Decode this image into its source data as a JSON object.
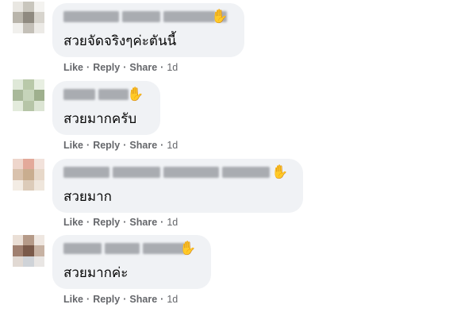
{
  "comments": [
    {
      "text": "สวยจัดจริงๆค่ะตันนี้",
      "like": "Like",
      "reply": "Reply",
      "share": "Share",
      "time": "1d",
      "badge_icon": "waving-hand-icon"
    },
    {
      "text": "สวยมากครับ",
      "like": "Like",
      "reply": "Reply",
      "share": "Share",
      "time": "1d",
      "badge_icon": "waving-hand-icon"
    },
    {
      "text": "สวยมาก",
      "like": "Like",
      "reply": "Reply",
      "share": "Share",
      "time": "1d",
      "badge_icon": "waving-hand-icon"
    },
    {
      "text": "สวยมากค่ะ",
      "like": "Like",
      "reply": "Reply",
      "share": "Share",
      "time": "1d",
      "badge_icon": "waving-hand-icon"
    }
  ],
  "separator": "·",
  "badge_glyph": "✋",
  "colors": {
    "bubble": "#f0f2f5",
    "meta": "#65676b",
    "text": "#050505"
  }
}
